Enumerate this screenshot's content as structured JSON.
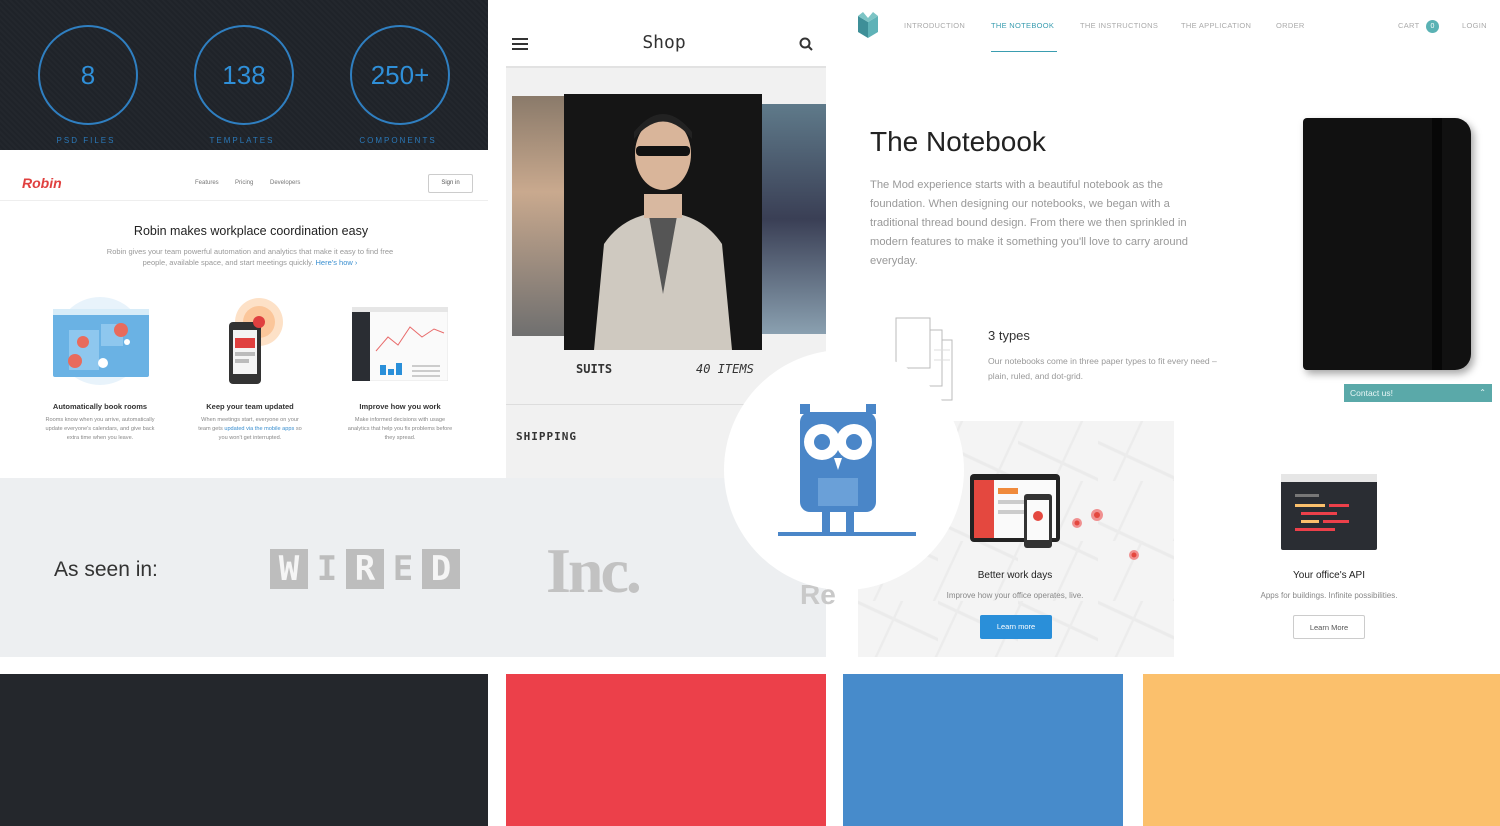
{
  "stats": {
    "items": [
      {
        "value": "8",
        "label": "PSD FILES"
      },
      {
        "value": "138",
        "label": "TEMPLATES"
      },
      {
        "value": "250+",
        "label": "COMPONENTS"
      }
    ]
  },
  "robin": {
    "logo": "Robin",
    "nav": [
      "Features",
      "Pricing",
      "Developers"
    ],
    "signin": "Sign in",
    "headline": "Robin makes workplace coordination easy",
    "subline_1": "Robin gives your team powerful automation and analytics that make it easy to find free",
    "subline_2": "people, available space, and start meetings quickly.",
    "subline_link": "Here's how ›",
    "features": [
      {
        "title": "Automatically book rooms",
        "desc_1": "Rooms know when you arrive, automatically",
        "desc_2": "update everyone's calendars, and give back",
        "desc_3": "extra time when you leave."
      },
      {
        "title": "Keep your team updated",
        "desc_1": "When meetings start, everyone on your",
        "desc_2a": "team gets",
        "desc_2_link": "updated via the mobile apps",
        "desc_2b": "so",
        "desc_3": "you won't get interrupted."
      },
      {
        "title": "Improve how you work",
        "desc_1": "Make informed decisions with usage",
        "desc_2": "analytics that help you fix problems before",
        "desc_3": "they spread."
      }
    ]
  },
  "shop": {
    "title": "Shop",
    "category": "SUITS",
    "count": "40 ITEMS",
    "shipping": "SHIPPING"
  },
  "seen": {
    "label": "As seen in:",
    "logos": {
      "wired": [
        "W",
        "I",
        "R",
        "E",
        "D"
      ],
      "inc": "Inc.",
      "partial": "Re"
    }
  },
  "notebook": {
    "nav": [
      "INTRODUCTION",
      "THE NOTEBOOK",
      "THE INSTRUCTIONS",
      "THE APPLICATION",
      "ORDER"
    ],
    "cart": "CART",
    "cart_count": "0",
    "login": "LOGIN",
    "title": "The Notebook",
    "body": "The Mod experience starts with a beautiful notebook as the foundation. When designing our notebooks, we began with a traditional thread bound design. From there we then sprinkled in modern features to make it something you'll love to carry around everyday.",
    "types_title": "3 types",
    "types_desc": "Our notebooks come in three paper types to fit every need – plain, ruled, and dot-grid.",
    "contact": "Contact us!"
  },
  "workdays": {
    "left_title": "Better work days",
    "left_desc": "Improve how your office operates, live.",
    "left_button": "Learn more",
    "right_title": "Your office's API",
    "right_desc": "Apps for buildings. Infinite possibilities.",
    "right_button": "Learn More"
  },
  "palette": [
    "#24272c",
    "#ec404a",
    "#478bcb",
    "#fbc06c"
  ]
}
